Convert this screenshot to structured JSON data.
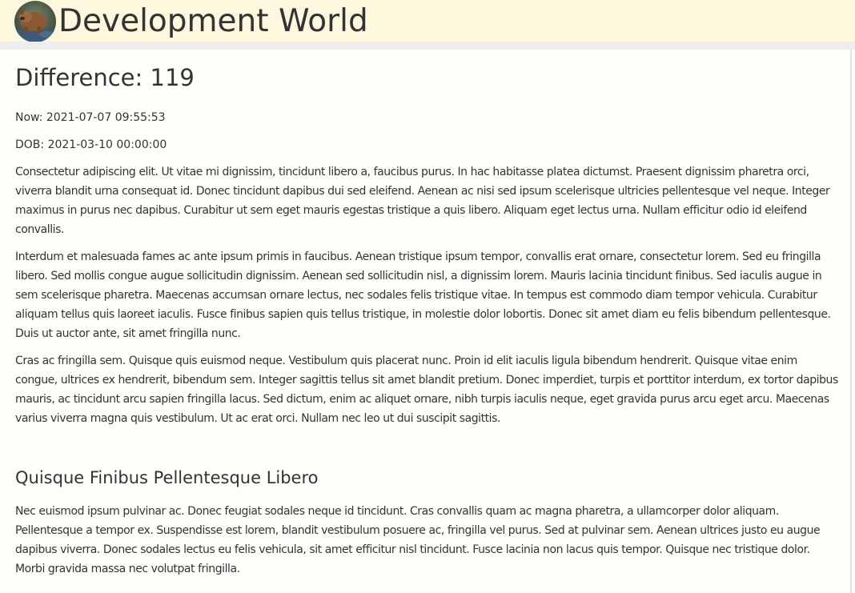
{
  "header": {
    "site_title": "Development World",
    "avatar_icon": "bear-photo-avatar",
    "background_color": "#fdf7de"
  },
  "main": {
    "title": "Difference: 119",
    "now": "Now: 2021-07-07 09:55:53",
    "dob": "DOB: 2021-03-10 00:00:00",
    "paragraphs": [
      "Consectetur adipiscing elit. Ut vitae mi dignissim, tincidunt libero a, faucibus purus. In hac habitasse platea dictumst. Praesent dignissim pharetra orci, viverra blandit urna consequat id. Donec tincidunt dapibus dui sed eleifend. Aenean ac nisi sed ipsum scelerisque ultricies pellentesque vel neque. Integer maximus in purus nec dapibus. Curabitur ut sem eget mauris egestas tristique a quis libero. Aliquam eget lectus urna. Nullam efficitur odio id eleifend convallis.",
      "Interdum et malesuada fames ac ante ipsum primis in faucibus. Aenean tristique ipsum tempor, convallis erat ornare, consectetur lorem. Sed eu fringilla libero. Sed mollis congue augue sollicitudin dignissim. Aenean sed sollicitudin nisl, a dignissim lorem. Mauris lacinia tincidunt finibus. Sed iaculis augue in sem scelerisque pharetra. Maecenas accumsan ornare lectus, nec sodales felis tristique vitae. In tempus est commodo diam tempor vehicula. Curabitur aliquam tellus quis laoreet iaculis. Fusce finibus sapien quis tellus tristique, in molestie dolor lobortis. Donec sit amet diam eu felis bibendum pellentesque. Duis ut auctor ante, sit amet fringilla nunc.",
      "Cras ac fringilla sem. Quisque quis euismod neque. Vestibulum quis placerat nunc. Proin id elit iaculis ligula bibendum hendrerit. Quisque vitae enim congue, ultrices ex hendrerit, bibendum sem. Integer sagittis tellus sit amet blandit pretium. Donec imperdiet, turpis et porttitor interdum, ex tortor dapibus mauris, ac tincidunt arcu sapien fringilla lacus. Sed dictum, enim ac aliquet ornare, nibh turpis iaculis neque, eget gravida purus arcu eget arcu. Maecenas varius viverra magna quis vestibulum. Ut ac erat orci. Nullam nec leo ut dui suscipit sagittis."
    ],
    "section": {
      "heading": "Quisque Finibus Pellentesque Libero",
      "paragraph": "Nec euismod ipsum pulvinar ac. Donec feugiat sodales neque id tincidunt. Cras convallis quam ac magna pharetra, a ullamcorper dolor aliquam. Pellentesque a tempor ex. Suspendisse est lorem, blandit vestibulum posuere ac, fringilla vel purus. Sed at pulvinar sem. Aenean ultrices justo eu augue dapibus viverra. Donec sodales lectus eu felis vehicula, sit amet efficitur nisl tincidunt. Fusce lacinia non lacus quis tempor. Quisque nec tristique dolor. Morbi gravida massa nec volutpat fringilla."
    }
  }
}
